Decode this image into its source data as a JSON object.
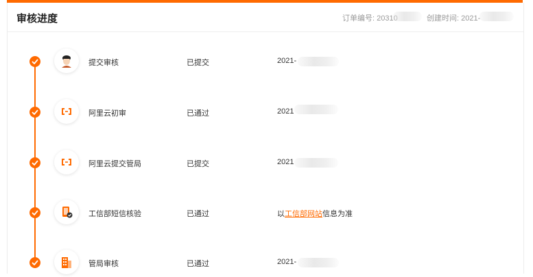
{
  "header": {
    "title": "审核进度",
    "order_label": "订单编号: 20310",
    "time_label": "创建时间: 2021-"
  },
  "colors": {
    "accent": "#ff6a00"
  },
  "steps": [
    {
      "icon": "person-avatar-icon",
      "name": "提交审核",
      "status": "已提交",
      "info": "2021-",
      "done": true
    },
    {
      "icon": "aliyun-logo-icon",
      "name": "阿里云初审",
      "status": "已通过",
      "info": "2021",
      "done": true
    },
    {
      "icon": "aliyun-logo-icon",
      "name": "阿里云提交管局",
      "status": "已提交",
      "info": "2021",
      "done": true
    },
    {
      "icon": "phone-verify-icon",
      "name": "工信部短信核验",
      "status": "已通过",
      "info_prefix": "以",
      "info_link": "工信部网站",
      "info_suffix": "信息为准",
      "done": true
    },
    {
      "icon": "building-icon",
      "name": "管局审核",
      "status": "已通过",
      "info": "2021-",
      "done": true
    }
  ]
}
